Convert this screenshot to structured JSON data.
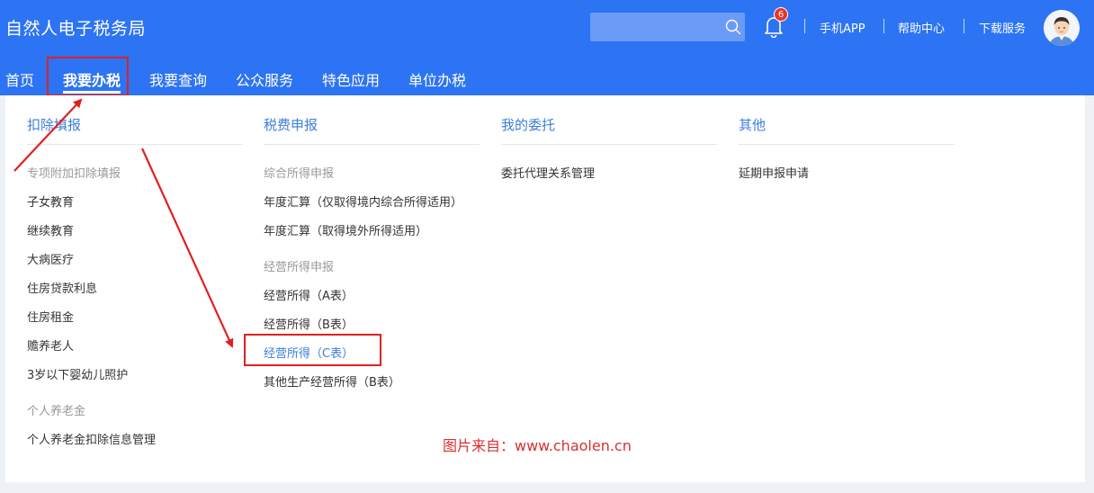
{
  "app": {
    "title": "自然人电子税务局"
  },
  "search": {
    "placeholder": ""
  },
  "notifications": {
    "count": "6"
  },
  "top_links": [
    "手机APP",
    "帮助中心",
    "下载服务"
  ],
  "nav": {
    "items": [
      "首页",
      "我要办税",
      "我要查询",
      "公众服务",
      "特色应用",
      "单位办税"
    ],
    "active": "我要办税"
  },
  "menu": {
    "columns": [
      {
        "title": "扣除填报",
        "groups": [
          {
            "title": "专项附加扣除填报",
            "items": [
              "子女教育",
              "继续教育",
              "大病医疗",
              "住房贷款利息",
              "住房租金",
              "赡养老人",
              "3岁以下婴幼儿照护"
            ]
          },
          {
            "title": "个人养老金",
            "items": [
              "个人养老金扣除信息管理"
            ]
          }
        ]
      },
      {
        "title": "税费申报",
        "groups": [
          {
            "title": "综合所得申报",
            "items": [
              "年度汇算（仅取得境内综合所得适用）",
              "年度汇算（取得境外所得适用）"
            ]
          },
          {
            "title": "经营所得申报",
            "items": [
              "经营所得（A表）",
              "经营所得（B表）",
              "经营所得（C表）",
              "其他生产经营所得（B表）"
            ]
          }
        ]
      },
      {
        "title": "我的委托",
        "groups": [
          {
            "title": "",
            "items": [
              "委托代理关系管理"
            ]
          }
        ]
      },
      {
        "title": "其他",
        "groups": [
          {
            "title": "",
            "items": [
              "延期申报申请"
            ]
          }
        ]
      }
    ],
    "selected_item": "经营所得（C表）"
  },
  "watermark": "图片来自：www.chaolen.cn",
  "colors": {
    "header_bg": "#2d74f4",
    "link_blue": "#3d7fd9",
    "annotation_red": "#e02020",
    "badge_red": "#e8352e"
  }
}
